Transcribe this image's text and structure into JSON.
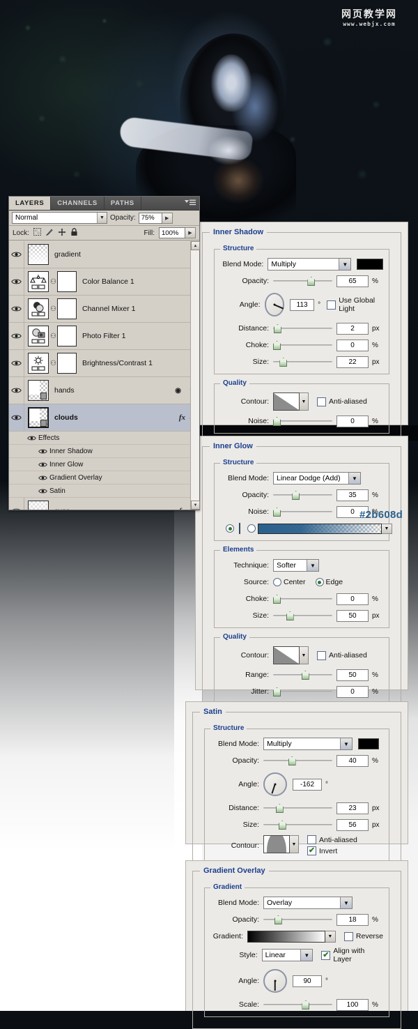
{
  "watermark": {
    "cn": "网页教学网",
    "en": "www.webjx.com"
  },
  "layers_panel": {
    "tabs": [
      {
        "label": "LAYERS",
        "active": true
      },
      {
        "label": "CHANNELS",
        "active": false
      },
      {
        "label": "PATHS",
        "active": false
      }
    ],
    "menu_icon": "panel-menu-icon",
    "blend_mode": "Normal",
    "opacity_label": "Opacity:",
    "opacity_value": "75%",
    "fill_label": "Fill:",
    "fill_value": "100%",
    "lock_label": "Lock:",
    "lock_icons": [
      "lock-transparent-icon",
      "lock-image-icon",
      "lock-position-icon",
      "lock-all-icon"
    ],
    "layers": [
      {
        "name": "gradient",
        "type": "pixel",
        "visible": true,
        "selected": false,
        "fx": false,
        "has_mask": false
      },
      {
        "name": "Color Balance 1",
        "type": "adjustment-color-balance",
        "visible": true,
        "selected": false,
        "fx": false,
        "has_mask": true
      },
      {
        "name": "Channel Mixer 1",
        "type": "adjustment-channel-mixer",
        "visible": true,
        "selected": false,
        "fx": false,
        "has_mask": true
      },
      {
        "name": "Photo Filter 1",
        "type": "adjustment-photo-filter",
        "visible": true,
        "selected": false,
        "fx": false,
        "has_mask": true
      },
      {
        "name": "Brightness/Contrast 1",
        "type": "adjustment-brightness-contrast",
        "visible": true,
        "selected": false,
        "fx": false,
        "has_mask": true
      },
      {
        "name": "hands",
        "type": "pixel",
        "visible": true,
        "selected": false,
        "fx": false,
        "has_mask": false
      },
      {
        "name": "clouds",
        "type": "pixel",
        "visible": true,
        "selected": true,
        "fx": true,
        "has_mask": false
      },
      {
        "name": "eyes",
        "type": "pixel",
        "visible": true,
        "selected": false,
        "fx": true,
        "has_mask": false
      }
    ],
    "effects_group_label": "Effects",
    "effects": [
      "Inner Shadow",
      "Inner Glow",
      "Gradient Overlay",
      "Satin"
    ]
  },
  "inner_shadow": {
    "title": "Inner Shadow",
    "structure_label": "Structure",
    "quality_label": "Quality",
    "blend_mode_label": "Blend Mode:",
    "blend_mode": "Multiply",
    "color": "#000000",
    "opacity_label": "Opacity:",
    "opacity": "65",
    "opacity_unit": "%",
    "angle_label": "Angle:",
    "angle": "113",
    "angle_unit": "°",
    "use_global_light": "Use Global Light",
    "use_global_light_checked": false,
    "distance_label": "Distance:",
    "distance": "2",
    "distance_unit": "px",
    "choke_label": "Choke:",
    "choke": "0",
    "choke_unit": "%",
    "size_label": "Size:",
    "size": "22",
    "size_unit": "px",
    "contour_label": "Contour:",
    "anti_aliased": "Anti-aliased",
    "anti_aliased_checked": false,
    "noise_label": "Noise:",
    "noise": "0",
    "noise_unit": "%"
  },
  "inner_glow": {
    "title": "Inner Glow",
    "structure_label": "Structure",
    "elements_label": "Elements",
    "quality_label": "Quality",
    "blend_mode_label": "Blend Mode:",
    "blend_mode": "Linear Dodge (Add)",
    "opacity_label": "Opacity:",
    "opacity": "35",
    "opacity_unit": "%",
    "noise_label": "Noise:",
    "noise": "0",
    "noise_unit": "%",
    "fill_type": "color",
    "color": "#2b608d",
    "color_hex_annotation": "#2b608d",
    "technique_label": "Technique:",
    "technique": "Softer",
    "source_label": "Source:",
    "source_center": "Center",
    "source_edge": "Edge",
    "source_selected": "Edge",
    "choke_label": "Choke:",
    "choke": "0",
    "choke_unit": "%",
    "size_label": "Size:",
    "size": "50",
    "size_unit": "px",
    "contour_label": "Contour:",
    "anti_aliased": "Anti-aliased",
    "anti_aliased_checked": false,
    "range_label": "Range:",
    "range": "50",
    "range_unit": "%",
    "jitter_label": "Jitter:",
    "jitter": "0",
    "jitter_unit": "%"
  },
  "satin": {
    "title": "Satin",
    "structure_label": "Structure",
    "blend_mode_label": "Blend Mode:",
    "blend_mode": "Multiply",
    "color": "#000000",
    "opacity_label": "Opacity:",
    "opacity": "40",
    "opacity_unit": "%",
    "angle_label": "Angle:",
    "angle": "-162",
    "angle_unit": "°",
    "distance_label": "Distance:",
    "distance": "23",
    "distance_unit": "px",
    "size_label": "Size:",
    "size": "56",
    "size_unit": "px",
    "contour_label": "Contour:",
    "anti_aliased": "Anti-aliased",
    "anti_aliased_checked": false,
    "invert": "Invert",
    "invert_checked": true
  },
  "gradient_overlay": {
    "title": "Gradient Overlay",
    "gradient_label": "Gradient",
    "blend_mode_label": "Blend Mode:",
    "blend_mode": "Overlay",
    "opacity_label": "Opacity:",
    "opacity": "18",
    "opacity_unit": "%",
    "gradient_field_label": "Gradient:",
    "reverse": "Reverse",
    "reverse_checked": false,
    "style_label": "Style:",
    "style": "Linear",
    "align_with_layer": "Align with Layer",
    "align_with_layer_checked": true,
    "angle_label": "Angle:",
    "angle": "90",
    "angle_unit": "°",
    "scale_label": "Scale:",
    "scale": "100",
    "scale_unit": "%"
  }
}
